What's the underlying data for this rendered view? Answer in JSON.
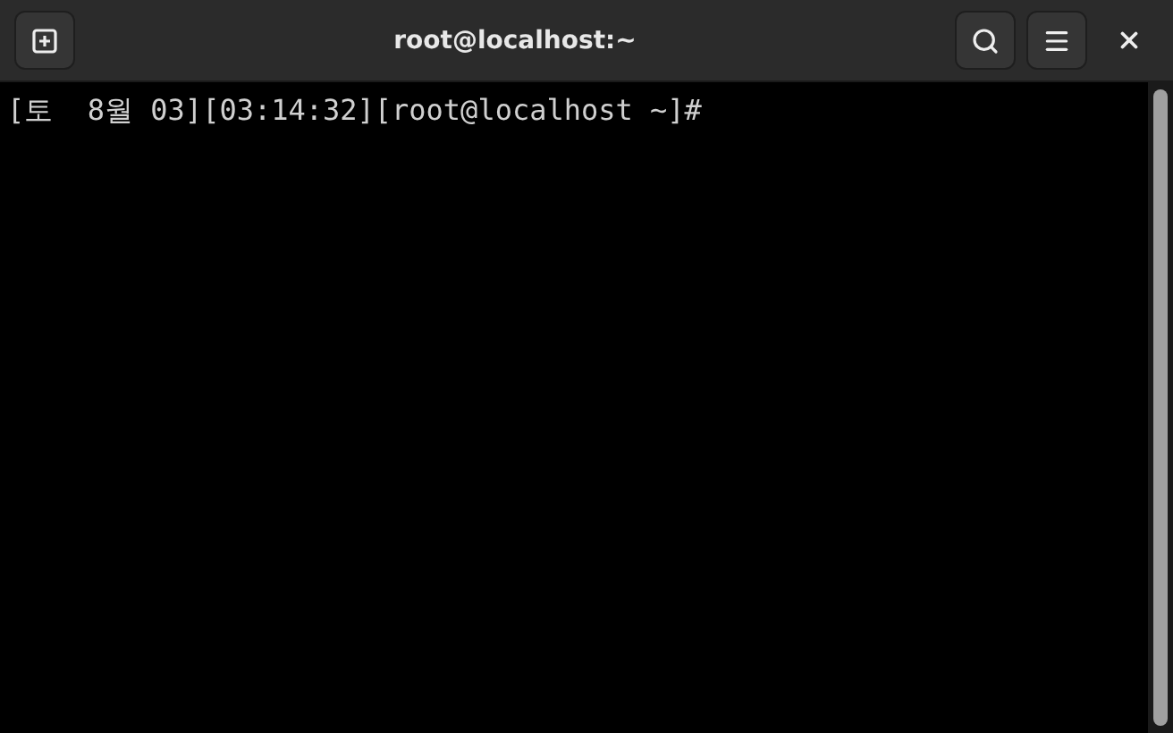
{
  "window": {
    "title": "root@localhost:~"
  },
  "terminal": {
    "lines": [
      "[토  8월 03][03:14:32][root@localhost ~]#"
    ]
  }
}
